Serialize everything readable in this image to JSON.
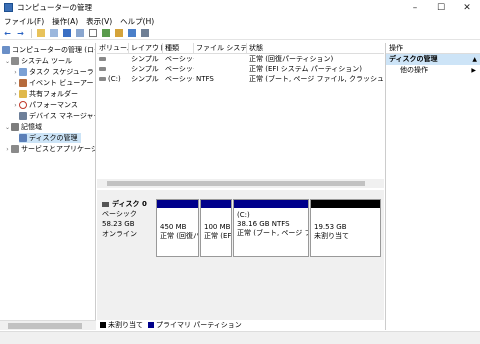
{
  "window": {
    "title": "コンピューターの管理",
    "minimize": "–",
    "maximize": "☐",
    "close": "✕"
  },
  "menu": [
    "ファイル(F)",
    "操作(A)",
    "表示(V)",
    "ヘルプ(H)"
  ],
  "tree": {
    "root": "コンピューターの管理 (ローカル)",
    "system_tools": "システム ツール",
    "task_scheduler": "タスク スケジューラ",
    "event_viewer": "イベント ビューアー",
    "shared_folders": "共有フォルダー",
    "performance": "パフォーマンス",
    "device_manager": "デバイス マネージャー",
    "storage": "記憶域",
    "disk_management": "ディスクの管理",
    "services": "サービスとアプリケーション"
  },
  "volume_columns": [
    "ボリューム",
    "レイアウト",
    "種類",
    "ファイル システム",
    "状態"
  ],
  "volumes": [
    {
      "volume": "",
      "layout": "シンプル",
      "type": "ベーシック",
      "fs": "",
      "status": "正常 (回復パーティション)"
    },
    {
      "volume": "",
      "layout": "シンプル",
      "type": "ベーシック",
      "fs": "",
      "status": "正常 (EFI システム パーティション)"
    },
    {
      "volume": "(C:)",
      "layout": "シンプル",
      "type": "ベーシック",
      "fs": "NTFS",
      "status": "正常 (ブート, ページ ファイル, クラッシュ ダンプ,"
    }
  ],
  "disk": {
    "name": "ディスク 0",
    "type": "ベーシック",
    "size": "58.23 GB",
    "state": "オンライン",
    "partitions": [
      {
        "name": "",
        "size": "450 MB",
        "status": "正常 (回復パ"
      },
      {
        "name": "",
        "size": "100 MB",
        "status": "正常 (EF"
      },
      {
        "name": "(C:)",
        "size": "38.16 GB NTFS",
        "status": "正常 (ブート, ページ ファ"
      },
      {
        "name": "",
        "size": "19.53 GB",
        "status": "未割り当て"
      }
    ]
  },
  "legend": {
    "unallocated": "未割り当て",
    "primary": "プライマリ パーティション"
  },
  "actions": {
    "header": "操作",
    "section": "ディスクの管理",
    "more": "他の操作",
    "arrow_up": "▲",
    "arrow_right": "▶"
  },
  "colors": {
    "primary": "#00008b",
    "unallocated": "#000000",
    "selection": "#cce4f7"
  }
}
